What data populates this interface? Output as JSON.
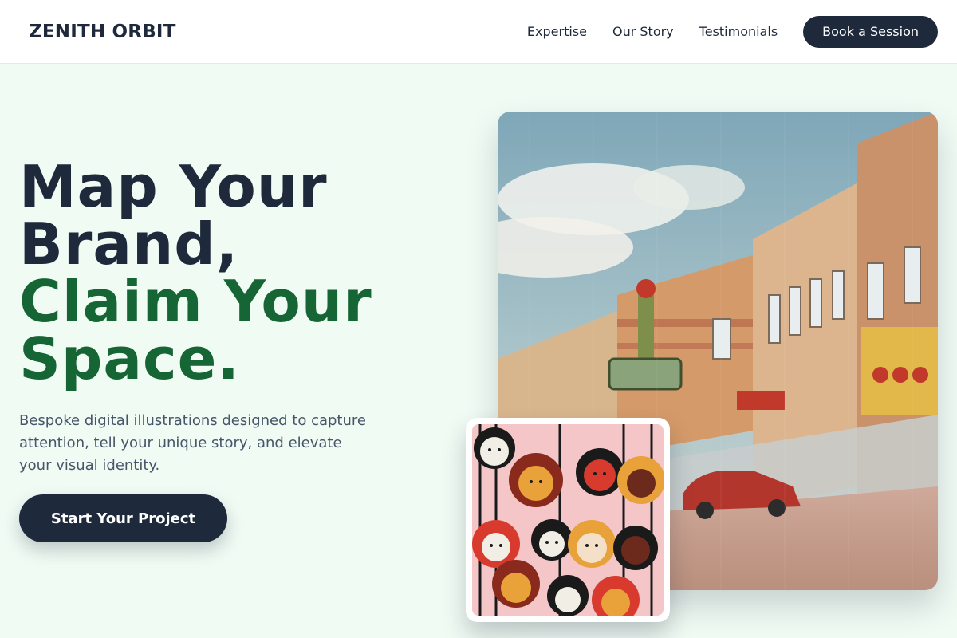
{
  "brand": {
    "name": "ZENITH ORBIT"
  },
  "nav": {
    "links": [
      "Expertise",
      "Our Story",
      "Testimonials"
    ],
    "cta_label": "Book a Session"
  },
  "hero": {
    "headline_lines": [
      "Map Your",
      "Brand,"
    ],
    "headline_accent_lines": [
      "Claim Your",
      "Space."
    ],
    "subtext": "Bespoke digital illustrations designed to capture attention, tell your unique story, and elevate your visual identity.",
    "cta_label": "Start Your Project"
  },
  "images": {
    "main": {
      "icon": "vintage-street-postcard-illustration"
    },
    "inset": {
      "icon": "crowd-of-faces-illustration"
    }
  },
  "colors": {
    "background": "#f0fbf4",
    "primary_dark": "#1e293b",
    "accent_green": "#166534",
    "body_text": "#475569"
  }
}
